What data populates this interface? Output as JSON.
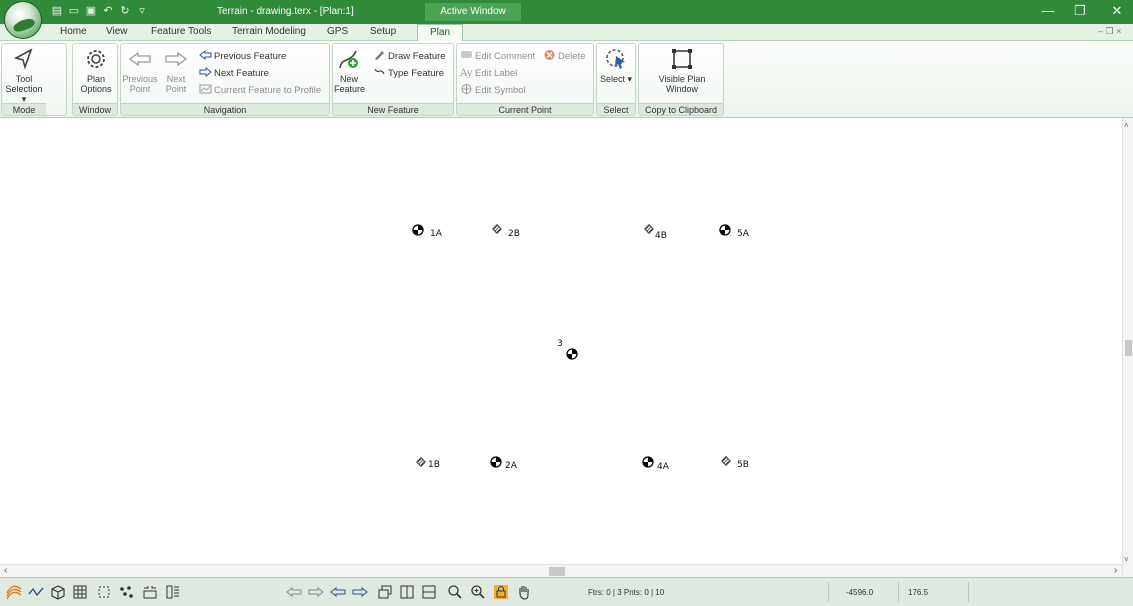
{
  "window": {
    "title": "Terrain - drawing.terx - [Plan:1]",
    "context_tab": "Active Window",
    "controls": {
      "minimize": "—",
      "restore": "❐",
      "close": "✕"
    },
    "mdi_controls": "– ❐ ×"
  },
  "ribbon_tabs": [
    {
      "label": "Home"
    },
    {
      "label": "View"
    },
    {
      "label": "Feature Tools"
    },
    {
      "label": "Terrain Modeling"
    },
    {
      "label": "GPS"
    },
    {
      "label": "Setup"
    },
    {
      "label": "Plan",
      "active": true
    }
  ],
  "ribbon": {
    "mode": {
      "label": "Mode",
      "tool_selection": "Tool Selection ▾"
    },
    "window": {
      "label": "Window",
      "plan_options": "Plan Options"
    },
    "navigation": {
      "label": "Navigation",
      "previous_point": "Previous Point",
      "next_point": "Next Point",
      "previous_feature": "Previous Feature",
      "next_feature": "Next Feature",
      "current_feature_to_profile": "Current Feature to Profile"
    },
    "new_feature": {
      "label": "New Feature",
      "new_feature": "New Feature",
      "draw_feature": "Draw Feature",
      "type_feature": "Type Feature"
    },
    "current_point": {
      "label": "Current Point",
      "edit_comment": "Edit Comment",
      "delete": "Delete",
      "edit_label": "Edit Label",
      "edit_symbol": "Edit Symbol"
    },
    "select": {
      "label": "Select",
      "select": "Select ▾"
    },
    "clipboard": {
      "label": "Copy to Clipboard",
      "visible_plan_window": "Visible Plan Window"
    }
  },
  "points": [
    {
      "label": "1A",
      "symbol": "control-point"
    },
    {
      "label": "2B",
      "symbol": "hatched-marker"
    },
    {
      "label": "4B",
      "symbol": "hatched-marker"
    },
    {
      "label": "5A",
      "symbol": "control-point"
    },
    {
      "label": "3",
      "symbol": "control-point"
    },
    {
      "label": "1B",
      "symbol": "hatched-marker"
    },
    {
      "label": "2A",
      "symbol": "control-point"
    },
    {
      "label": "4A",
      "symbol": "control-point"
    },
    {
      "label": "5B",
      "symbol": "hatched-marker"
    }
  ],
  "status": {
    "counts": "Ftrs: 0 | 3  Pnts: 0 | 10",
    "x": "-4596.0",
    "y": "176.5"
  },
  "colors": {
    "title_green": "#2f8a3a",
    "ribbon_bg": "#ecf3ec"
  }
}
